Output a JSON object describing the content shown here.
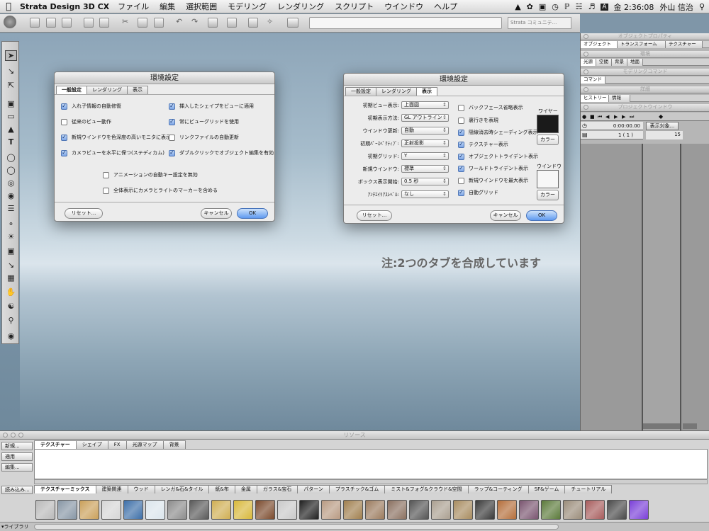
{
  "menubar": {
    "app_name": "Strata Design 3D CX",
    "items": [
      "ファイル",
      "編集",
      "選択範囲",
      "モデリング",
      "レンダリング",
      "スクリプト",
      "ウインドウ",
      "ヘルプ"
    ],
    "clock": "金 2:36:08",
    "user": "外山 信治",
    "status_icon_names": [
      "adobe-icon",
      "acrobat-icon",
      "display-icon",
      "time-machine-icon",
      "bluetooth-icon",
      "wifi-icon",
      "volume-icon",
      "input-menu-icon",
      "spotlight-icon"
    ]
  },
  "toolbar": {
    "combo_text": "Strata コミュニテ..."
  },
  "dialog_general": {
    "title": "環境設定",
    "tabs": [
      "一般設定",
      "レンダリング",
      "表示"
    ],
    "active_tab": "一般設定",
    "options": [
      {
        "label": "入れ子情報の自動修復",
        "checked": true
      },
      {
        "label": "挿入したシェイプをビューに適用",
        "checked": true
      },
      {
        "label": "従来のビュー動作",
        "checked": false
      },
      {
        "label": "常にビューグリッドを使用",
        "checked": true
      },
      {
        "label": "新規ウインドウを色深度の高いモニタに表示",
        "checked": true
      },
      {
        "label": "リンクファイルの自動更新",
        "checked": false
      },
      {
        "label": "カメラビューを水平に保つ(ステディカム)",
        "checked": true
      },
      {
        "label": "ダブルクリックでオブジェクト編集を有効",
        "checked": true
      },
      {
        "label": "アニメーションの自動キー設定を無効",
        "checked": false
      },
      {
        "label": "全体表示にカメラとライトのマーカーを含める",
        "checked": false
      }
    ],
    "reset_label": "リセット...",
    "cancel_label": "キャンセル",
    "ok_label": "OK"
  },
  "dialog_display": {
    "title": "環境設定",
    "tabs": [
      "一般設定",
      "レンダリング",
      "表示"
    ],
    "active_tab": "表示",
    "fields": [
      {
        "label": "初期ビュー表示:",
        "value": "上面図"
      },
      {
        "label": "初期表示方法:",
        "value": "GL アウトライン"
      },
      {
        "label": "ウインドウ更新:",
        "value": "自動"
      },
      {
        "label": "初期ﾊﾟｰｽﾍﾟｸﾃｨﾌﾞ:",
        "value": "正射投影"
      },
      {
        "label": "初期グリッド:",
        "value": "Y"
      },
      {
        "label": "新規ウインドウ:",
        "value": "標準"
      },
      {
        "label": "ボックス表示開始:",
        "value": "0.5 秒"
      },
      {
        "label": "ｱﾝﾁｴｲﾘｱｽﾚﾍﾞﾙ:",
        "value": "なし"
      }
    ],
    "options": [
      {
        "label": "バックフェース省略表示",
        "checked": false
      },
      {
        "label": "裏行きを表現",
        "checked": false
      },
      {
        "label": "隠線消去時シェーディング表示",
        "checked": true
      },
      {
        "label": "テクスチャー表示",
        "checked": true
      },
      {
        "label": "オブジェクトトライデント表示",
        "checked": true
      },
      {
        "label": "ワールドトライデント表示",
        "checked": true
      },
      {
        "label": "新規ウインドウを最大表示",
        "checked": false
      },
      {
        "label": "自動グリッド",
        "checked": true
      }
    ],
    "wire_label": "ワイヤー",
    "wire_color": "#1a1a1a",
    "window_label": "ウインドウ",
    "window_color": "#f7f7f7",
    "color_button_label": "カラー",
    "reset_label": "リセット...",
    "cancel_label": "キャンセル",
    "ok_label": "OK"
  },
  "note": "注:2つのタブを合成しています",
  "right_panel": {
    "object_properties": "オブジェクトプロパティ",
    "prop_tabs": [
      "オブジェクト",
      "トランスフォーム",
      "テクスチャー"
    ],
    "environment": "環境",
    "env_tabs": [
      "光源",
      "空間",
      "背景",
      "地面"
    ],
    "modeling_command": "モデリングコマンド",
    "command_tab": "コマンド",
    "detail": "詳細",
    "history_tabs": [
      "ヒストリー",
      "情報"
    ],
    "project_window": "プロジェクトウインドウ",
    "timecode": "0:00:00.00",
    "frame_value": "1 ( 1 )",
    "display_target": "表示対象...",
    "track_number": "15"
  },
  "resources": {
    "title": "リソース",
    "buttons": [
      "新規...",
      "適用",
      "編集..."
    ],
    "load_label": "読み込み...",
    "library_label": "ライブラリ",
    "top_tabs": [
      "テクスチャー",
      "シェイプ",
      "FX",
      "光源マップ",
      "背景"
    ],
    "library_tabs": [
      "テクスチャーミックス",
      "建築関連",
      "ウッド",
      "レンガ&石&タイル",
      "紙&布",
      "金属",
      "ガラス&宝石",
      "パターン",
      "プラスチック&ゴム",
      "ミスト&フォグ&クラウド&空間",
      "ラップ&コーティング",
      "SF&ゲーム",
      "チュートリアル"
    ],
    "active_library_tab": "テクスチャーミックス",
    "swatch_colors": [
      "#b9b9b9",
      "#8796a5",
      "#caa05a",
      "#d6d6d6",
      "#3d6fa8",
      "#dbe5ec",
      "#8c8c8c",
      "#5a5a5a",
      "#cfae52",
      "#d8b83a",
      "#7b4a2c",
      "#c9c9c9",
      "#202020",
      "#b89a82",
      "#a07f4e",
      "#9b7b5e",
      "#8a7060",
      "#555555",
      "#aa9f90",
      "#a88c60",
      "#3a3a3a",
      "#b46e3a",
      "#7a5570",
      "#5b7a3a",
      "#9a8c7a",
      "#a75c5c",
      "#4a4a4a",
      "#7a3fd8"
    ]
  }
}
